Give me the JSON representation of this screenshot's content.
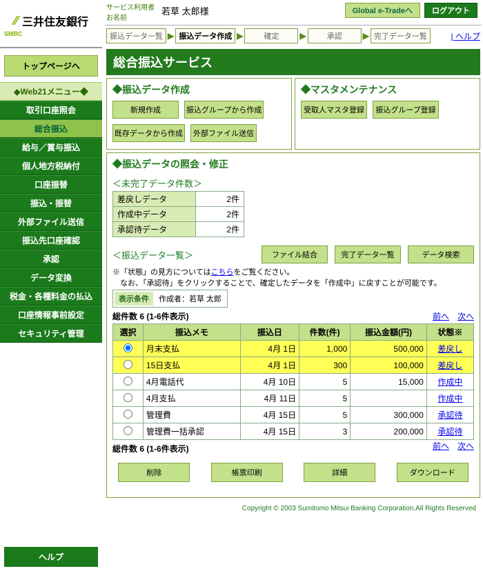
{
  "logo": {
    "name": "三井住友銀行",
    "sub": "SMBC"
  },
  "top_button": "トップページへ",
  "menu_header": "Web21メニュー",
  "menu": [
    {
      "label": "取引口座照会"
    },
    {
      "label": "総合振込",
      "selected": true
    },
    {
      "label": "給与／賞与振込"
    },
    {
      "label": "個人地方税納付"
    },
    {
      "label": "口座振替"
    },
    {
      "label": "振込・振替"
    },
    {
      "label": "外部ファイル送信"
    },
    {
      "label": "振込先口座確認"
    },
    {
      "label": "承認"
    },
    {
      "label": "データ変換"
    },
    {
      "label": "税金・各種料金の払込"
    },
    {
      "label": "口座情報事前設定"
    },
    {
      "label": "セキュリティ管理"
    }
  ],
  "help_button": "ヘルプ",
  "header": {
    "line1": "サービス利用者",
    "line2": "お名前",
    "user": "若草 太郎様",
    "etrade": "Global e-Tradeへ",
    "logout": "ログアウト"
  },
  "flow": [
    "振込データ一覧",
    "振込データ作成",
    "確定",
    "承認",
    "完了データ一覧"
  ],
  "help_link": "ヘルプ",
  "page_title": "総合振込サービス",
  "pane_create": {
    "title": "振込データ作成",
    "btns": [
      "新規作成",
      "振込グループから作成",
      "既存データから作成",
      "外部ファイル送信"
    ]
  },
  "pane_master": {
    "title": "マスタメンテナンス",
    "btns": [
      "受取人マスタ登録",
      "振込グループ登録"
    ]
  },
  "sec_title": "振込データの照会・修正",
  "pending": {
    "title": "＜未完了データ件数＞",
    "rows": [
      {
        "label": "差戻しデータ",
        "val": "2件"
      },
      {
        "label": "作成中データ",
        "val": "2件"
      },
      {
        "label": "承認待データ",
        "val": "2件"
      }
    ]
  },
  "list": {
    "title": "＜振込データ一覧＞",
    "btns": [
      "ファイル結合",
      "完了データ一覧",
      "データ検索"
    ],
    "note_pre": "※「状態」の見方については",
    "note_link": "こちら",
    "note_post": "をご覧ください。",
    "note2": "　なお、「承認待」をクリックすることで、確定したデータを「作成中」に戻すことが可能です。",
    "filter_label": "表示条件",
    "filter_key": "作成者：",
    "filter_val": "若草 太郎",
    "count": "総件数 6 (1-6件表示)",
    "prev": "前へ",
    "next": "次へ",
    "cols": [
      "選択",
      "振込メモ",
      "振込日",
      "件数(件)",
      "振込金額(円)",
      "状態※"
    ],
    "rows": [
      {
        "sel": true,
        "memo": "月末支払",
        "date": "4月 1日",
        "cnt": "1,000",
        "amt": "500,000",
        "stat": "差戻し"
      },
      {
        "sel": false,
        "hl": true,
        "memo": "15日支払",
        "date": "4月 1日",
        "cnt": "300",
        "amt": "100,000",
        "stat": "差戻し"
      },
      {
        "sel": false,
        "memo": "4月電話代",
        "date": "4月 10日",
        "cnt": "5",
        "amt": "15,000",
        "stat": "作成中"
      },
      {
        "sel": false,
        "memo": "4月支払",
        "date": "4月 11日",
        "cnt": "5",
        "amt": "",
        "stat": "作成中"
      },
      {
        "sel": false,
        "memo": "管理費",
        "date": "4月 15日",
        "cnt": "5",
        "amt": "300,000",
        "stat": "承認待"
      },
      {
        "sel": false,
        "memo": "管理費一括承認",
        "date": "4月 15日",
        "cnt": "3",
        "amt": "200,000",
        "stat": "承認待"
      }
    ]
  },
  "actions": [
    "削除",
    "帳票印刷",
    "詳細",
    "ダウンロード"
  ],
  "footer": "Copyright © 2003 Sumitomo Mitsui Banking Corporation.All Rights Reserved"
}
